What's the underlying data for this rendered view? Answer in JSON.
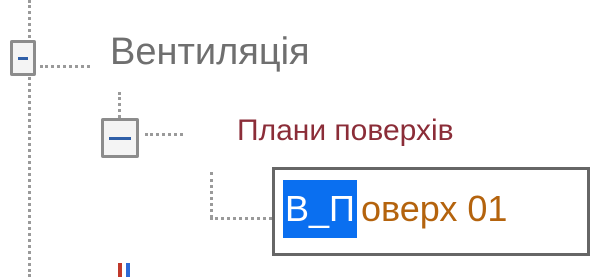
{
  "tree": {
    "root": {
      "label": "Вентиляція",
      "expanded": true,
      "toggle_icon": "minus-icon"
    },
    "child": {
      "label": "Плани поверхів",
      "expanded": true,
      "toggle_icon": "minus-icon"
    },
    "leaf": {
      "selected_text": "В_П",
      "remaining_text": "оверх 01"
    }
  },
  "colors": {
    "root_label": "#6f6f6f",
    "child_label": "#8b2d38",
    "leaf_label": "#b4630d",
    "selection": "#0a6ff0"
  }
}
